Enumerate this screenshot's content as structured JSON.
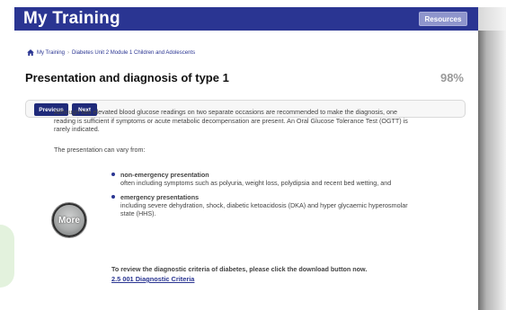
{
  "header": {
    "title": "My Training",
    "resources_label": "Resources",
    "background_color": "#2a3592"
  },
  "breadcrumb": {
    "home_icon": "home-icon",
    "items": [
      "My Training",
      "Diabetes Unit 2 Module 1 Children and Adolescents"
    ]
  },
  "page": {
    "title": "Presentation and diagnosis of type 1",
    "progress": "98%"
  },
  "nav": {
    "previous_label": "Previous",
    "next_label": "Next"
  },
  "content": {
    "paragraph": "Although two elevated blood glucose readings on two separate occasions are recommended to make the diagnosis, one reading is sufficient if symptoms or acute metabolic decompensation are present. An Oral Glucose Tolerance Test (OGTT) is rarely indicated.",
    "intro": "The presentation can vary from:",
    "more_label": "More",
    "bullets": [
      {
        "heading": "non-emergency presentation",
        "description": "often including symptoms such as polyuria, weight loss, polydipsia and recent bed wetting, and"
      },
      {
        "heading": "emergency presentations",
        "description": "including severe dehydration, shock, diabetic ketoacidosis (DKA) and hyper glycaemic hyperosmolar state (HHS)."
      }
    ],
    "download_instruction": "To review the diagnostic criteria of diabetes, please click the download button now.",
    "download_link": "2.5 001 Diagnostic Criteria"
  }
}
